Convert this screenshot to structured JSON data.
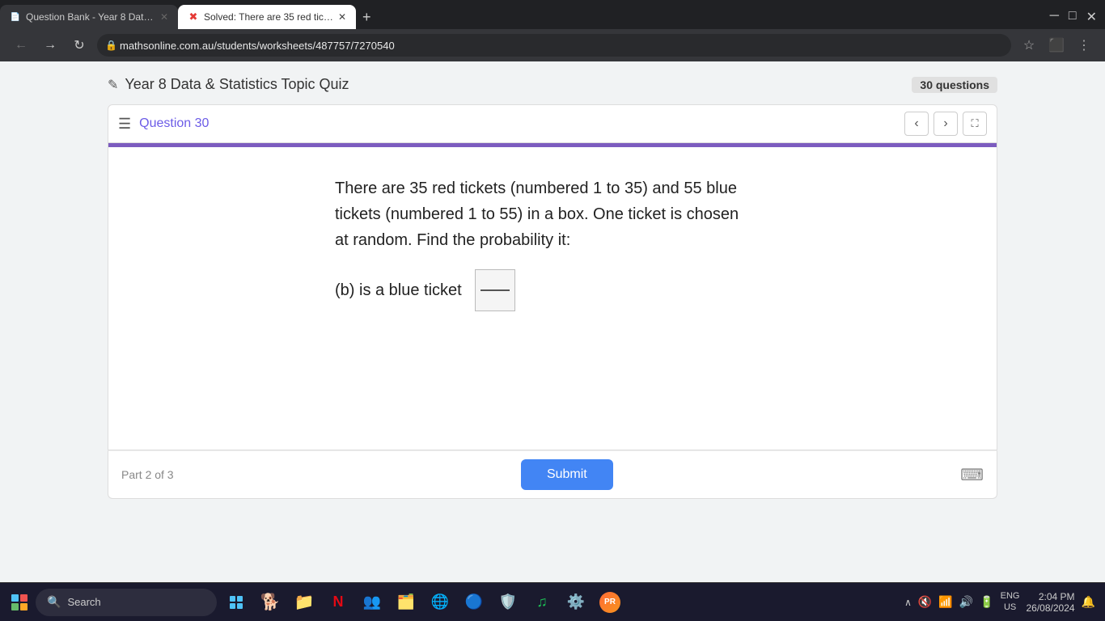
{
  "browser": {
    "tabs": [
      {
        "id": "tab1",
        "title": "Question Bank - Year 8 Data &",
        "active": false,
        "favicon": "📄"
      },
      {
        "id": "tab2",
        "title": "Solved: There are 35 red tickets",
        "active": true,
        "favicon": "❌"
      }
    ],
    "address": "mathsonline.com.au/students/worksheets/487757/7270540",
    "new_tab_label": "+"
  },
  "quiz": {
    "title": "Year 8 Data & Statistics Topic Quiz",
    "question_count_label": "30 questions",
    "question_count_number": "30",
    "current_question": "Question 30",
    "question_text": "There are 35 red tickets (numbered 1 to 35) and 55 blue tickets (numbered 1 to 55) in a box. One ticket is chosen at random. Find the probability it:",
    "part_label": "(b) is a blue ticket",
    "part_info": "Part 2 of 3",
    "submit_label": "Submit",
    "fraction_numerator": "",
    "fraction_denominator": ""
  },
  "taskbar": {
    "search_placeholder": "Search",
    "clock_time": "2:04 PM",
    "clock_date": "26/08/2024",
    "lang": "ENG",
    "region": "US"
  }
}
